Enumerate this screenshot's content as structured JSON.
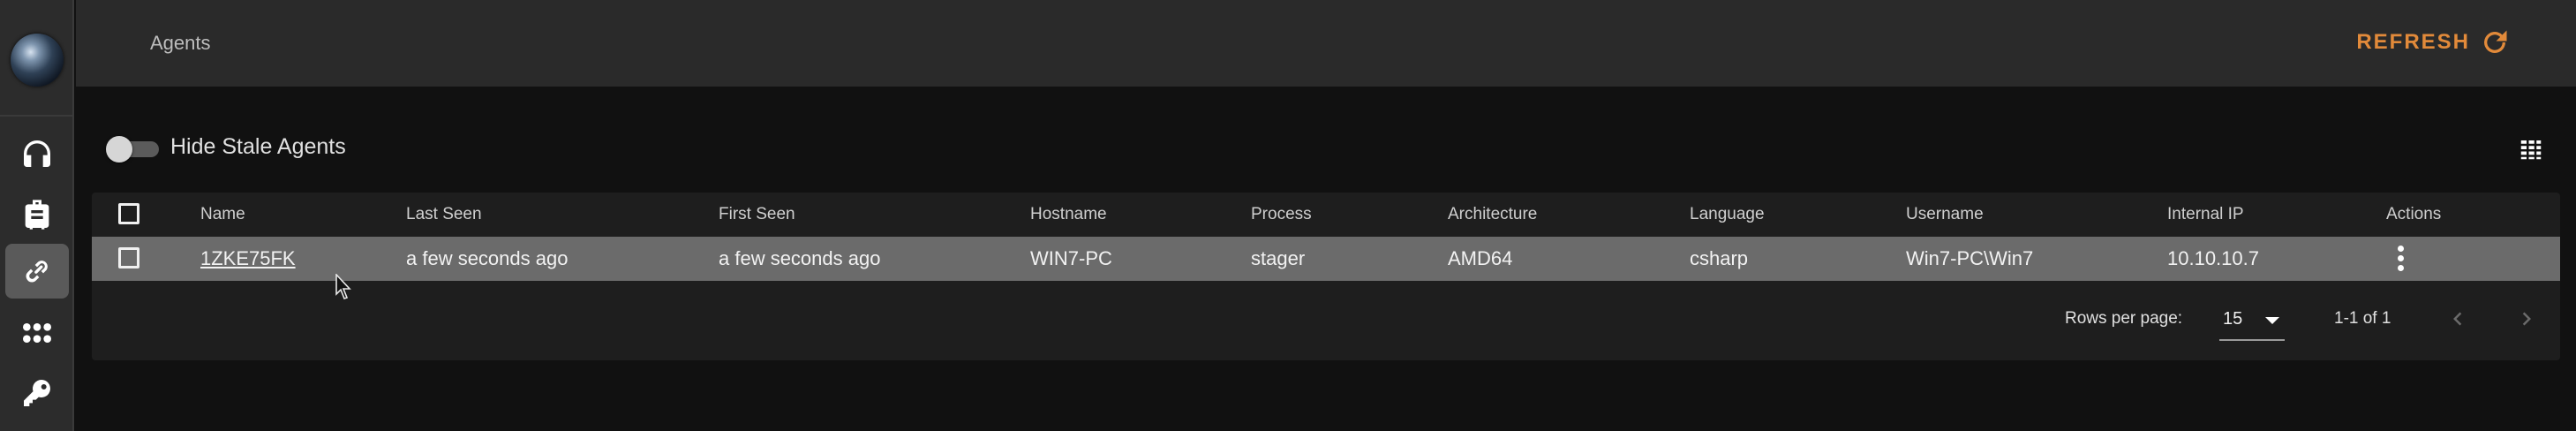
{
  "header": {
    "title": "Agents",
    "refresh_label": "REFRESH"
  },
  "sidebar": {
    "items": [
      {
        "icon": "headphones-icon"
      },
      {
        "icon": "briefcase-icon"
      },
      {
        "icon": "link-icon",
        "active": true
      },
      {
        "icon": "grid-dots-icon"
      },
      {
        "icon": "key-icon"
      }
    ]
  },
  "toolbar": {
    "hide_stale_label": "Hide Stale Agents",
    "hide_stale_on": false
  },
  "table": {
    "columns": [
      "Name",
      "Last Seen",
      "First Seen",
      "Hostname",
      "Process",
      "Architecture",
      "Language",
      "Username",
      "Internal IP",
      "Actions"
    ],
    "rows": [
      {
        "name": "1ZKE75FK",
        "last_seen": "a few seconds ago",
        "first_seen": "a few seconds ago",
        "hostname": "WIN7-PC",
        "process": "stager",
        "architecture": "AMD64",
        "language": "csharp",
        "username": "Win7-PC\\Win7",
        "internal_ip": "10.10.10.7"
      }
    ]
  },
  "pagination": {
    "rows_per_page_label": "Rows per page:",
    "rows_per_page_value": "15",
    "range_text": "1-1 of 1"
  },
  "colors": {
    "accent": "#e28a3a",
    "selected_row": "#6b6b6b"
  }
}
